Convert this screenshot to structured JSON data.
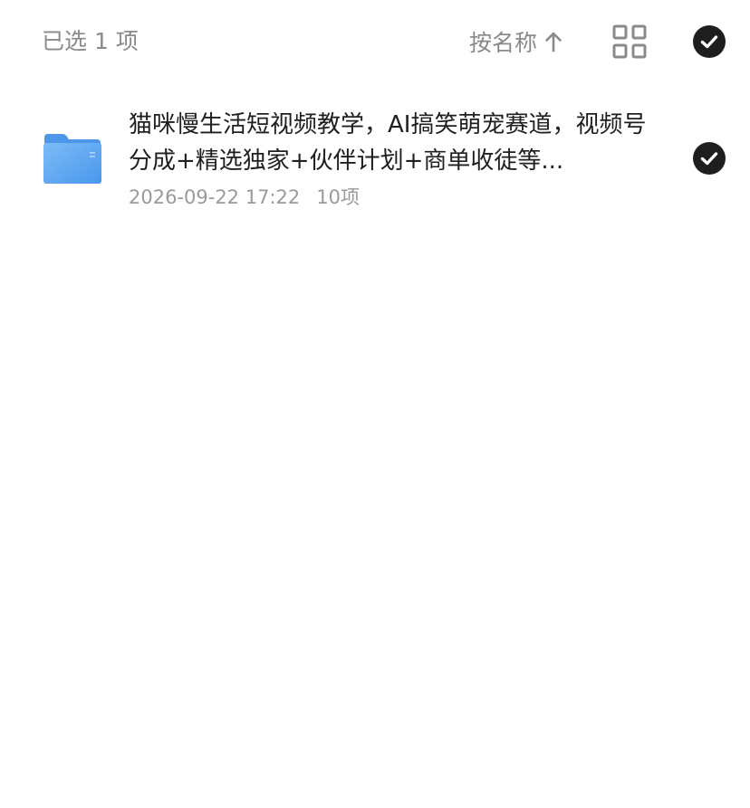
{
  "header": {
    "selected_label": "已选 1 项",
    "sort_label": "按名称",
    "sort_icon": "arrow-up-icon",
    "view_icon": "grid-view-icon",
    "select_all_icon": "check-circle-icon"
  },
  "files": [
    {
      "name": "猫咪慢生活短视频教学，AI搞笑萌宠赛道，视频号分成+精选独家+伙伴计划+商单收徒等...",
      "date": "2026-09-22 17:22",
      "count": "10项",
      "icon": "folder-icon",
      "selected": true
    }
  ],
  "colors": {
    "header_text": "#8a8a8a",
    "title_text": "#1f1f1f",
    "meta_text": "#9a9a9a",
    "check_fill": "#1e1e1e",
    "folder_blue": "#5aa7f2"
  }
}
